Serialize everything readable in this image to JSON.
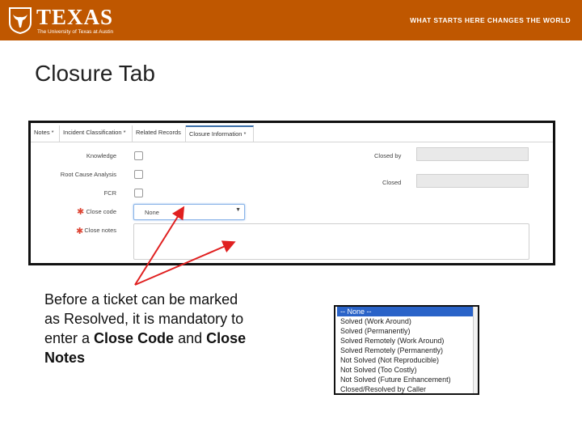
{
  "header": {
    "logo_word": "TEXAS",
    "logo_sub": "The University of Texas at Austin",
    "tagline": "WHAT STARTS HERE CHANGES THE WORLD",
    "brand_color": "#bf5700"
  },
  "slide": {
    "title": "Closure Tab"
  },
  "form": {
    "tabs": [
      {
        "label": "Notes *"
      },
      {
        "label": "Incident Classification *"
      },
      {
        "label": "Related Records"
      },
      {
        "label": "Closure Information *"
      }
    ],
    "fields": {
      "knowledge": "Knowledge",
      "root_cause": "Root Cause Analysis",
      "fcr": "FCR",
      "close_code": "Close code",
      "close_code_value": "None",
      "close_notes": "Close notes",
      "closed_by": "Closed by",
      "closed": "Closed"
    }
  },
  "note": {
    "part1": "Before a ticket can be marked as Resolved, it is mandatory to enter a ",
    "bold1": "Close Code",
    "part2": " and ",
    "bold2": "Close Notes"
  },
  "dropdown": {
    "options": [
      "-- None --",
      "Solved (Work Around)",
      "Solved (Permanently)",
      "Solved Remotely (Work Around)",
      "Solved Remotely (Permanently)",
      "Not Solved (Not Reproducible)",
      "Not Solved (Too Costly)",
      "Not Solved (Future Enhancement)",
      "Closed/Resolved by Caller"
    ]
  }
}
